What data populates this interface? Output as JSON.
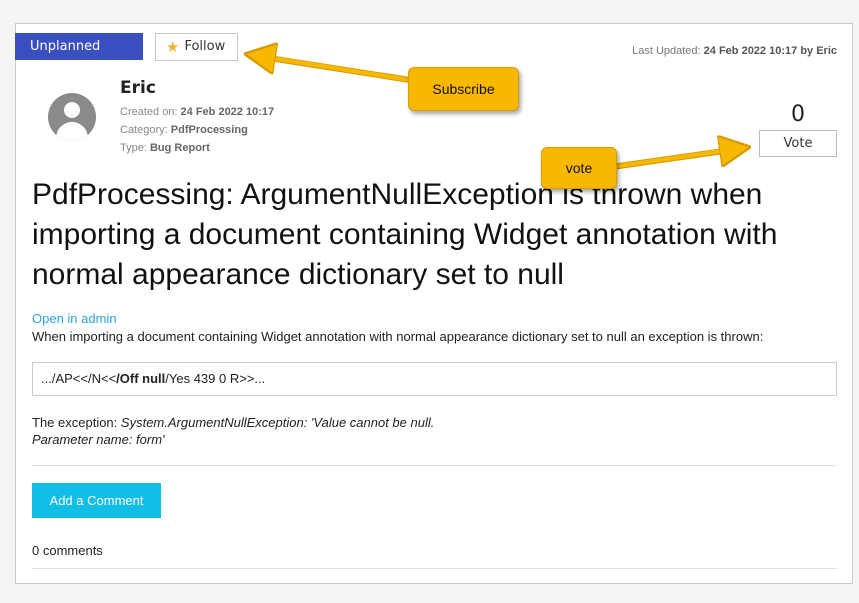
{
  "status": "Unplanned",
  "follow_label": "Follow",
  "last_updated": {
    "label": "Last Updated:",
    "date": "24 Feb 2022 10:17",
    "by": "by Eric"
  },
  "author": "Eric",
  "meta": {
    "created_label": "Created on:",
    "created_value": "24 Feb 2022 10:17",
    "category_label": "Category:",
    "category_value": "PdfProcessing",
    "type_label": "Type:",
    "type_value": "Bug Report"
  },
  "vote": {
    "count": "0",
    "label": "Vote"
  },
  "title": "PdfProcessing: ArgumentNullException is thrown when importing a document containing Widget annotation with normal appearance dictionary set to null",
  "open_in_admin": "Open in admin",
  "description": "When importing a document containing Widget annotation with normal appearance dictionary set to null an exception is thrown:",
  "code": {
    "prefix": ".../AP<</N<<",
    "bold": "/Off null",
    "suffix": "/Yes 439 0 R>>..."
  },
  "exception": {
    "label": "The exception:",
    "line1": "System.ArgumentNullException: 'Value cannot be null.",
    "line2": "Parameter name: form'"
  },
  "add_comment_label": "Add a Comment",
  "comments_count": "0 comments",
  "callouts": {
    "subscribe": "Subscribe",
    "vote": "vote"
  },
  "colors": {
    "status": "#3a4fbf",
    "accent": "#12bde6",
    "link": "#2ca3dc",
    "callout": "#f9b800"
  },
  "icons": {
    "follow": "star-icon",
    "avatar": "user-avatar-icon"
  }
}
